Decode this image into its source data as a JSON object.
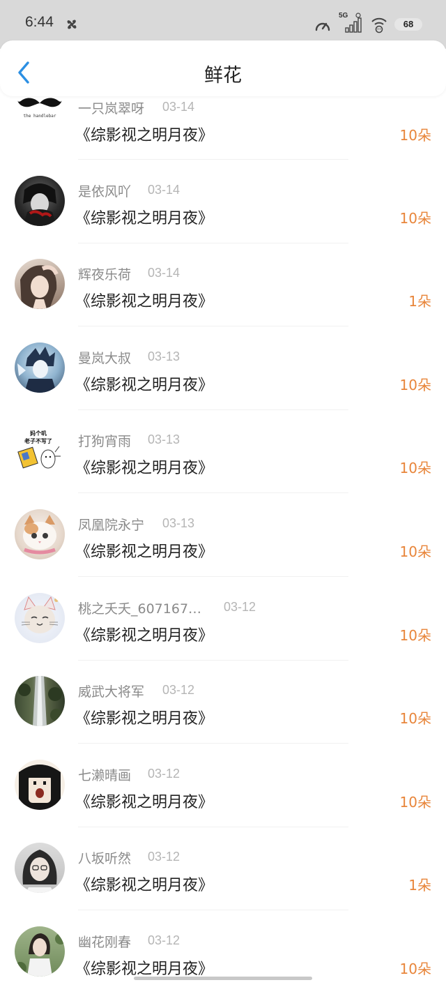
{
  "status_bar": {
    "time": "6:44",
    "network": "5G",
    "battery": "68"
  },
  "header": {
    "title": "鲜花"
  },
  "items": [
    {
      "user": "一只岚翠呀",
      "date": "03-14",
      "book": "《综影视之明月夜》",
      "count": "10朵",
      "avatar": "mustache",
      "avatar_caption": "the handlebar"
    },
    {
      "user": "是依风吖",
      "date": "03-14",
      "book": "《综影视之明月夜》",
      "count": "10朵",
      "avatar": "dark"
    },
    {
      "user": "辉夜乐荷",
      "date": "03-14",
      "book": "《综影视之明月夜》",
      "count": "1朵",
      "avatar": "girl"
    },
    {
      "user": "曼岚大叔",
      "date": "03-13",
      "book": "《综影视之明月夜》",
      "count": "10朵",
      "avatar": "anime-blue"
    },
    {
      "user": "打狗宵雨",
      "date": "03-13",
      "book": "《综影视之明月夜》",
      "count": "10朵",
      "avatar": "sticker",
      "avatar_caption_line1": "妈个叽",
      "avatar_caption_line2": "老子不写了"
    },
    {
      "user": "凤凰院永宁",
      "date": "03-13",
      "book": "《综影视之明月夜》",
      "count": "10朵",
      "avatar": "cat"
    },
    {
      "user": "桃之夭夭_607167…",
      "date": "03-12",
      "book": "《综影视之明月夜》",
      "count": "10朵",
      "avatar": "cat-ears"
    },
    {
      "user": "威武大将军",
      "date": "03-12",
      "book": "《综影视之明月夜》",
      "count": "10朵",
      "avatar": "waterfall"
    },
    {
      "user": "七濑晴画",
      "date": "03-12",
      "book": "《综影视之明月夜》",
      "count": "10朵",
      "avatar": "cartoon-girl"
    },
    {
      "user": "八坂听然",
      "date": "03-12",
      "book": "《综影视之明月夜》",
      "count": "1朵",
      "avatar": "glasses-girl"
    },
    {
      "user": "幽花刚春",
      "date": "03-12",
      "book": "《综影视之明月夜》",
      "count": "10朵",
      "avatar": "outdoor-girl"
    }
  ],
  "colors": {
    "count": "#e8853a",
    "back": "#2b8fe3",
    "name": "#8a8a8a",
    "date": "#b5b5b5"
  }
}
